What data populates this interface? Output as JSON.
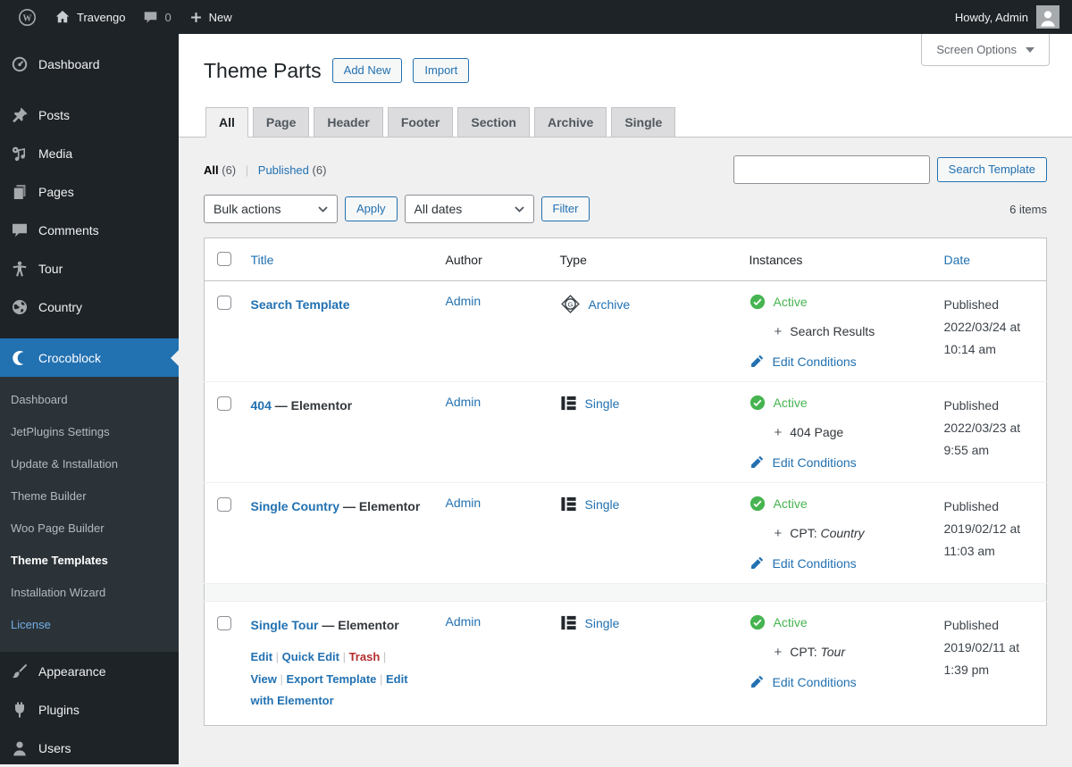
{
  "colors": {
    "accent": "#2271b1",
    "active_green": "#46b450",
    "trash_red": "#b32d2e",
    "sidebar_bg": "#1d2327",
    "body_bg": "#f0f0f1"
  },
  "admin_bar": {
    "site_name": "Travengo",
    "comment_count": "0",
    "new_label": "New",
    "greeting": "Howdy, Admin"
  },
  "sidebar": {
    "items": [
      {
        "label": "Dashboard",
        "icon": "dashboard-gauge"
      },
      {
        "label": "Posts",
        "icon": "pushpin"
      },
      {
        "label": "Media",
        "icon": "media-notes"
      },
      {
        "label": "Pages",
        "icon": "stacked-pages"
      },
      {
        "label": "Comments",
        "icon": "comment-bubble"
      },
      {
        "label": "Tour",
        "icon": "person-figure"
      },
      {
        "label": "Country",
        "icon": "globe"
      },
      {
        "label": "Crocoblock",
        "icon": "crocoblock-crescent",
        "active": true
      },
      {
        "label": "Appearance",
        "icon": "paintbrush"
      },
      {
        "label": "Plugins",
        "icon": "plug"
      },
      {
        "label": "Users",
        "icon": "user"
      }
    ],
    "submenu": [
      {
        "label": "Dashboard"
      },
      {
        "label": "JetPlugins Settings"
      },
      {
        "label": "Update & Installation"
      },
      {
        "label": "Theme Builder"
      },
      {
        "label": "Woo Page Builder"
      },
      {
        "label": "Theme Templates",
        "active": true
      },
      {
        "label": "Installation Wizard"
      },
      {
        "label": "License",
        "highlight": true
      }
    ]
  },
  "page": {
    "title": "Theme Parts",
    "add_new_label": "Add New",
    "import_label": "Import",
    "screen_options_label": "Screen Options"
  },
  "tabs": [
    {
      "label": "All",
      "active": true
    },
    {
      "label": "Page"
    },
    {
      "label": "Header"
    },
    {
      "label": "Footer"
    },
    {
      "label": "Section"
    },
    {
      "label": "Archive"
    },
    {
      "label": "Single"
    }
  ],
  "filters": {
    "all_label": "All",
    "all_count": "(6)",
    "published_label": "Published",
    "published_count": "(6)",
    "bulk_actions_value": "Bulk actions",
    "apply_label": "Apply",
    "all_dates_value": "All dates",
    "filter_label": "Filter",
    "search_value": "",
    "search_button_label": "Search Template",
    "items_count": "6 items"
  },
  "table": {
    "columns": {
      "title": "Title",
      "author": "Author",
      "type": "Type",
      "instances": "Instances",
      "date": "Date"
    },
    "rows": [
      {
        "title": "Search Template",
        "suffix": "",
        "author": "Admin",
        "type_icon": "gutenberg-diamond-g",
        "type": "Archive",
        "status": "Active",
        "plus": "+",
        "instance": "Search Results",
        "instance_italic": "",
        "edit_conditions": "Edit Conditions",
        "date_lines": [
          "Published",
          "2022/03/24 at",
          "10:14 am"
        ]
      },
      {
        "title": "404",
        "suffix": " — Elementor",
        "author": "Admin",
        "type_icon": "elementor-e",
        "type": "Single",
        "status": "Active",
        "plus": "+",
        "instance": "404 Page",
        "instance_italic": "",
        "edit_conditions": "Edit Conditions",
        "date_lines": [
          "Published",
          "2022/03/23 at",
          "9:55 am"
        ]
      },
      {
        "title": "Single Country",
        "suffix": " — Elementor",
        "author": "Admin",
        "type_icon": "elementor-e",
        "type": "Single",
        "status": "Active",
        "plus": "+",
        "instance": "CPT: ",
        "instance_italic": "Country",
        "edit_conditions": "Edit Conditions",
        "date_lines": [
          "Published",
          "2019/02/12 at",
          "11:03 am"
        ]
      },
      {
        "title": "Single Tour",
        "suffix": " — Elementor",
        "author": "Admin",
        "type_icon": "elementor-e",
        "type": "Single",
        "status": "Active",
        "plus": "+",
        "instance": "CPT: ",
        "instance_italic": "Tour",
        "edit_conditions": "Edit Conditions",
        "date_lines": [
          "Published",
          "2019/02/11 at",
          "1:39 pm"
        ],
        "actions": [
          {
            "label": "Edit"
          },
          {
            "label": "Quick Edit"
          },
          {
            "label": "Trash",
            "danger": true
          },
          {
            "label": "View"
          },
          {
            "label": "Export Template"
          },
          {
            "label": "Edit with Elementor"
          }
        ]
      }
    ]
  }
}
